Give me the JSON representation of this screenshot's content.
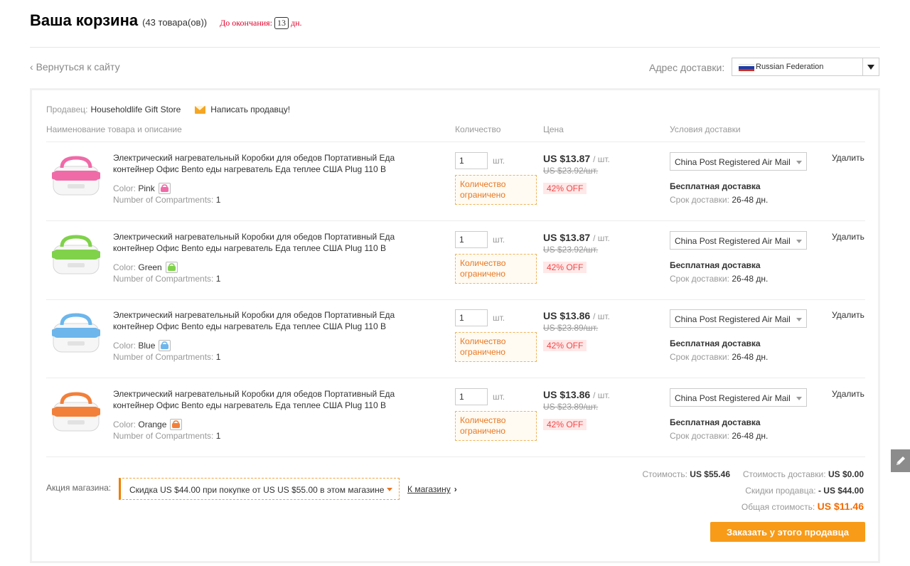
{
  "header": {
    "title": "Ваша корзина",
    "count": "(43 товара(ов))",
    "deadline_label": "До окончания:",
    "deadline_days": "13",
    "deadline_unit": "дн."
  },
  "nav": {
    "back_link": "Вернуться к сайту",
    "ship_to_label": "Адрес доставки:",
    "country": "Russian Federation"
  },
  "seller": {
    "label": "Продавец:",
    "name": "Householdlife Gift Store",
    "contact": "Написать продавцу!"
  },
  "columns": {
    "product": "Наименование товара и описание",
    "quantity": "Количество",
    "price": "Цена",
    "shipping": "Условия доставки"
  },
  "items": [
    {
      "title": "Электрический нагревательный Коробки для обедов Портативный Еда контейнер Офис Bento еды нагреватель Еда теплее США Plug 110 В",
      "color_label": "Color:",
      "color": "Pink",
      "comp_label": "Number of Compartments:",
      "comp": "1",
      "qty": "1",
      "qty_unit": "шт.",
      "qty_note": "Количество ограничено",
      "price": "US $13.87",
      "per": "/ шт.",
      "old_price": "US $23.92/шт.",
      "discount": "42% OFF",
      "ship_method": "China Post Registered Air Mail",
      "free_ship": "Бесплатная доставка",
      "delivery_label": "Срок доставки:",
      "delivery": "26-48 дн.",
      "remove": "Удалить",
      "accent": "#f06aa8"
    },
    {
      "title": "Электрический нагревательный Коробки для обедов Портативный Еда контейнер Офис Bento еды нагреватель Еда теплее США Plug 110 В",
      "color_label": "Color:",
      "color": "Green",
      "comp_label": "Number of Compartments:",
      "comp": "1",
      "qty": "1",
      "qty_unit": "шт.",
      "qty_note": "Количество ограничено",
      "price": "US $13.87",
      "per": "/ шт.",
      "old_price": "US $23.92/шт.",
      "discount": "42% OFF",
      "ship_method": "China Post Registered Air Mail",
      "free_ship": "Бесплатная доставка",
      "delivery_label": "Срок доставки:",
      "delivery": "26-48 дн.",
      "remove": "Удалить",
      "accent": "#7fd24a"
    },
    {
      "title": "Электрический нагревательный Коробки для обедов Портативный Еда контейнер Офис Bento еды нагреватель Еда теплее США Plug 110 В",
      "color_label": "Color:",
      "color": "Blue",
      "comp_label": "Number of Compartments:",
      "comp": "1",
      "qty": "1",
      "qty_unit": "шт.",
      "qty_note": "Количество ограничено",
      "price": "US $13.86",
      "per": "/ шт.",
      "old_price": "US $23.89/шт.",
      "discount": "42% OFF",
      "ship_method": "China Post Registered Air Mail",
      "free_ship": "Бесплатная доставка",
      "delivery_label": "Срок доставки:",
      "delivery": "26-48 дн.",
      "remove": "Удалить",
      "accent": "#6cb6ec"
    },
    {
      "title": "Электрический нагревательный Коробки для обедов Портативный Еда контейнер Офис Bento еды нагреватель Еда теплее США Plug 110 В",
      "color_label": "Color:",
      "color": "Orange",
      "comp_label": "Number of Compartments:",
      "comp": "1",
      "qty": "1",
      "qty_unit": "шт.",
      "qty_note": "Количество ограничено",
      "price": "US $13.86",
      "per": "/ шт.",
      "old_price": "US $23.89/шт.",
      "discount": "42% OFF",
      "ship_method": "China Post Registered Air Mail",
      "free_ship": "Бесплатная доставка",
      "delivery_label": "Срок доставки:",
      "delivery": "26-48 дн.",
      "remove": "Удалить",
      "accent": "#f2803a"
    }
  ],
  "promo": {
    "label": "Акция магазина:",
    "offer": "Скидка US $44.00 при покупке от US US $55.00 в этом магазине",
    "store_link": "К магазину"
  },
  "summary": {
    "cost_label": "Стоимость:",
    "cost": "US $55.46",
    "shipping_label": "Стоимость доставки:",
    "shipping": "US $0.00",
    "discount_label": "Скидки продавца:",
    "discount": "- US $44.00",
    "total_label": "Общая стоимость:",
    "total": "US $11.46",
    "order_button": "Заказать у этого продавца"
  },
  "colors": {
    "accent_orange": "#f79b19",
    "discount_red": "#f04848",
    "deadline_red": "#e4002b"
  }
}
